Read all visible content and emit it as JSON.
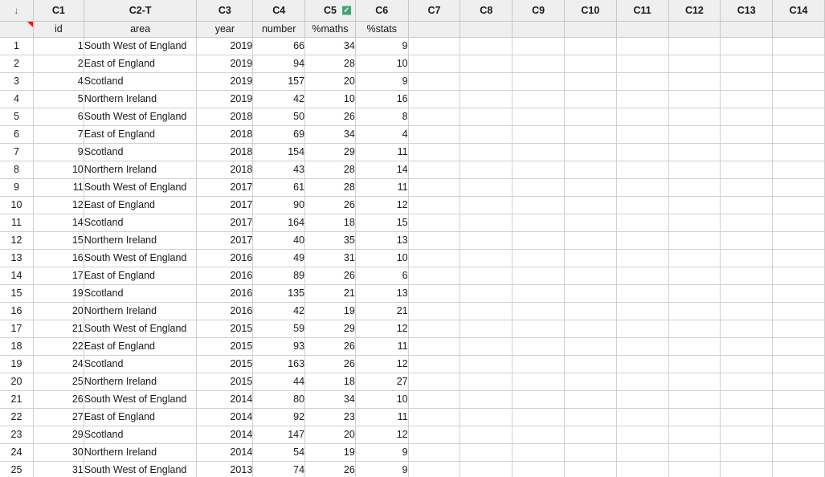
{
  "worksheet": {
    "corner_icon": "down-arrow-icon",
    "corner_glyph": "↓",
    "name_marker": "red-triangle-marker",
    "column_headers": [
      {
        "id": "C1",
        "label": "C1",
        "badge": null
      },
      {
        "id": "C2-T",
        "label": "C2-T",
        "badge": null
      },
      {
        "id": "C3",
        "label": "C3",
        "badge": null
      },
      {
        "id": "C4",
        "label": "C4",
        "badge": null
      },
      {
        "id": "C5",
        "label": "C5",
        "badge": "check-badge-icon"
      },
      {
        "id": "C6",
        "label": "C6",
        "badge": null
      },
      {
        "id": "C7",
        "label": "C7",
        "badge": null
      },
      {
        "id": "C8",
        "label": "C8",
        "badge": null
      },
      {
        "id": "C9",
        "label": "C9",
        "badge": null
      },
      {
        "id": "C10",
        "label": "C10",
        "badge": null
      },
      {
        "id": "C11",
        "label": "C11",
        "badge": null
      },
      {
        "id": "C12",
        "label": "C12",
        "badge": null
      },
      {
        "id": "C13",
        "label": "C13",
        "badge": null
      },
      {
        "id": "C14",
        "label": "C14",
        "badge": null
      }
    ],
    "column_names": [
      "id",
      "area",
      "year",
      "number",
      "%maths",
      "%stats",
      "",
      "",
      "",
      "",
      "",
      "",
      "",
      ""
    ],
    "badge_color": "#4a9e7a",
    "marker_color": "#e01b1b",
    "selection": {
      "columns": [
        "C9",
        "C10"
      ],
      "active_cell": "C10 row 1"
    },
    "row_numbers": [
      1,
      2,
      3,
      4,
      5,
      6,
      7,
      8,
      9,
      10,
      11,
      12,
      13,
      14,
      15,
      16,
      17,
      18,
      19,
      20,
      21,
      22,
      23,
      24,
      25
    ],
    "rows": [
      {
        "id": "1",
        "area": "South West of England",
        "year": "2019",
        "number": "66",
        "maths": "34",
        "stats": "9"
      },
      {
        "id": "2",
        "area": "East of England",
        "year": "2019",
        "number": "94",
        "maths": "28",
        "stats": "10"
      },
      {
        "id": "4",
        "area": "Scotland",
        "year": "2019",
        "number": "157",
        "maths": "20",
        "stats": "9"
      },
      {
        "id": "5",
        "area": "Northern Ireland",
        "year": "2019",
        "number": "42",
        "maths": "10",
        "stats": "16"
      },
      {
        "id": "6",
        "area": "South West of England",
        "year": "2018",
        "number": "50",
        "maths": "26",
        "stats": "8"
      },
      {
        "id": "7",
        "area": "East of England",
        "year": "2018",
        "number": "69",
        "maths": "34",
        "stats": "4"
      },
      {
        "id": "9",
        "area": "Scotland",
        "year": "2018",
        "number": "154",
        "maths": "29",
        "stats": "11"
      },
      {
        "id": "10",
        "area": "Northern Ireland",
        "year": "2018",
        "number": "43",
        "maths": "28",
        "stats": "14"
      },
      {
        "id": "11",
        "area": "South West of England",
        "year": "2017",
        "number": "61",
        "maths": "28",
        "stats": "11"
      },
      {
        "id": "12",
        "area": "East of England",
        "year": "2017",
        "number": "90",
        "maths": "26",
        "stats": "12"
      },
      {
        "id": "14",
        "area": "Scotland",
        "year": "2017",
        "number": "164",
        "maths": "18",
        "stats": "15"
      },
      {
        "id": "15",
        "area": "Northern Ireland",
        "year": "2017",
        "number": "40",
        "maths": "35",
        "stats": "13"
      },
      {
        "id": "16",
        "area": "South West of England",
        "year": "2016",
        "number": "49",
        "maths": "31",
        "stats": "10"
      },
      {
        "id": "17",
        "area": "East of England",
        "year": "2016",
        "number": "89",
        "maths": "26",
        "stats": "6"
      },
      {
        "id": "19",
        "area": "Scotland",
        "year": "2016",
        "number": "135",
        "maths": "21",
        "stats": "13"
      },
      {
        "id": "20",
        "area": "Northern Ireland",
        "year": "2016",
        "number": "42",
        "maths": "19",
        "stats": "21"
      },
      {
        "id": "21",
        "area": "South West of England",
        "year": "2015",
        "number": "59",
        "maths": "29",
        "stats": "12"
      },
      {
        "id": "22",
        "area": "East of England",
        "year": "2015",
        "number": "93",
        "maths": "26",
        "stats": "11"
      },
      {
        "id": "24",
        "area": "Scotland",
        "year": "2015",
        "number": "163",
        "maths": "26",
        "stats": "12"
      },
      {
        "id": "25",
        "area": "Northern Ireland",
        "year": "2015",
        "number": "44",
        "maths": "18",
        "stats": "27"
      },
      {
        "id": "26",
        "area": "South West of England",
        "year": "2014",
        "number": "80",
        "maths": "34",
        "stats": "10"
      },
      {
        "id": "27",
        "area": "East of England",
        "year": "2014",
        "number": "92",
        "maths": "23",
        "stats": "11"
      },
      {
        "id": "29",
        "area": "Scotland",
        "year": "2014",
        "number": "147",
        "maths": "20",
        "stats": "12"
      },
      {
        "id": "30",
        "area": "Northern Ireland",
        "year": "2014",
        "number": "54",
        "maths": "19",
        "stats": "9"
      },
      {
        "id": "31",
        "area": "South West of England",
        "year": "2013",
        "number": "74",
        "maths": "26",
        "stats": "9"
      }
    ]
  }
}
